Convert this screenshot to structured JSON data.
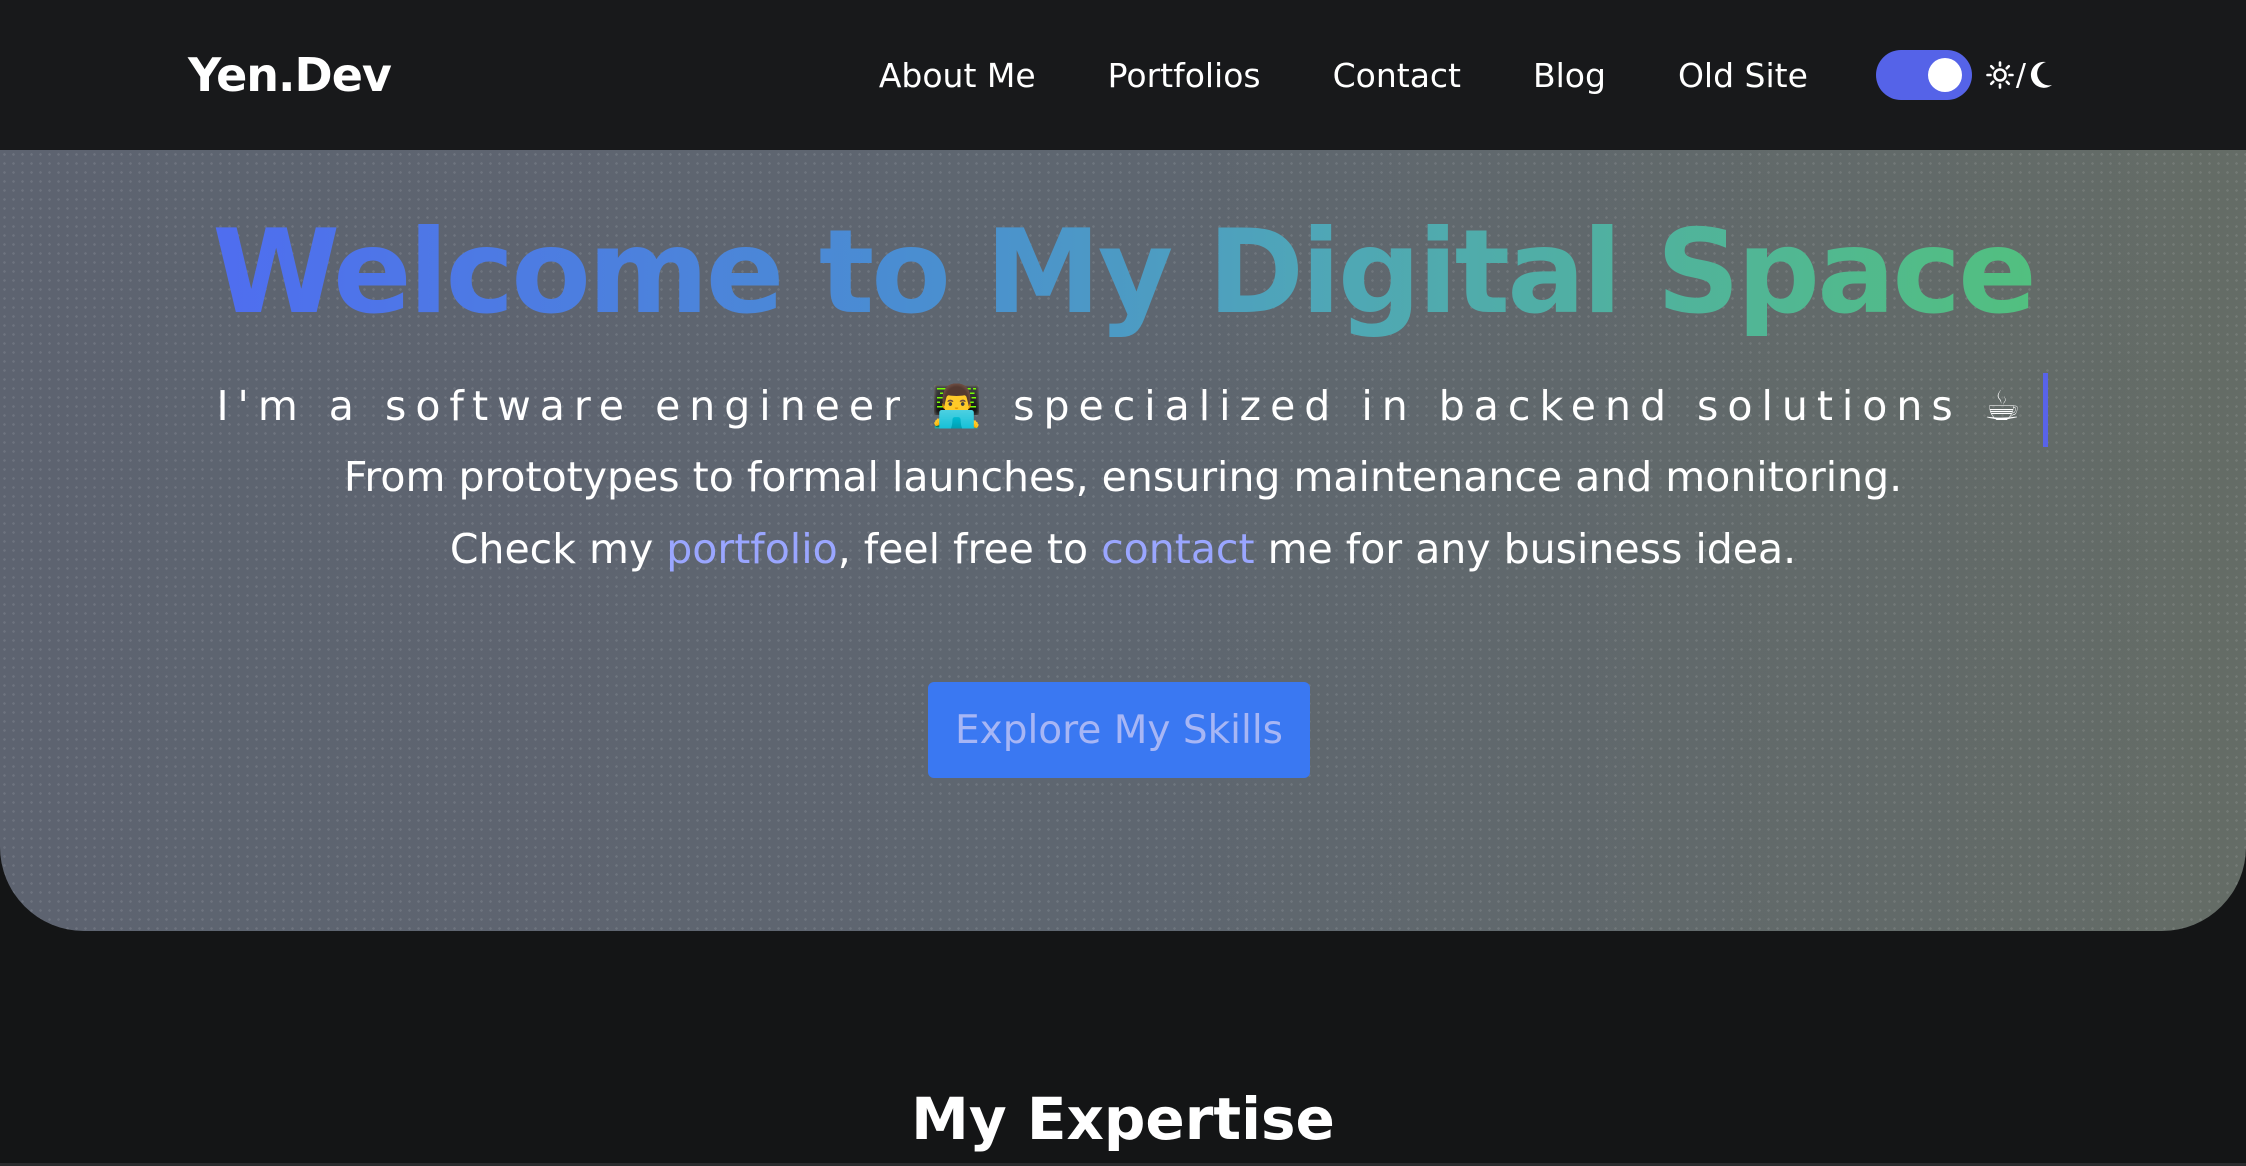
{
  "navbar": {
    "brand": "Yen.Dev",
    "links": [
      "About Me",
      "Portfolios",
      "Contact",
      "Blog",
      "Old Site"
    ],
    "theme_toggle": {
      "state": "on",
      "label_separator": "/",
      "icons": [
        "sun-icon",
        "moon-icon"
      ],
      "accent": "#5563e8"
    }
  },
  "hero": {
    "title": "Welcome to My Digital Space",
    "typing_text": "I'm a software engineer 👨‍💻 specialized in backend solutions ☕",
    "line1": "From prototypes to formal launches, ensuring maintenance and monitoring.",
    "line2_prefix": "Check my ",
    "line2_link1": "portfolio",
    "line2_middle": ", feel free to ",
    "line2_link2": "contact",
    "line2_suffix": " me for any business idea.",
    "cta_label": "Explore My Skills",
    "colors": {
      "title_start": "#4f6df0",
      "title_end": "#52c07f",
      "cta": "#3a78f2",
      "link": "#9aa6ff"
    }
  },
  "expertise": {
    "title": "My Expertise"
  }
}
